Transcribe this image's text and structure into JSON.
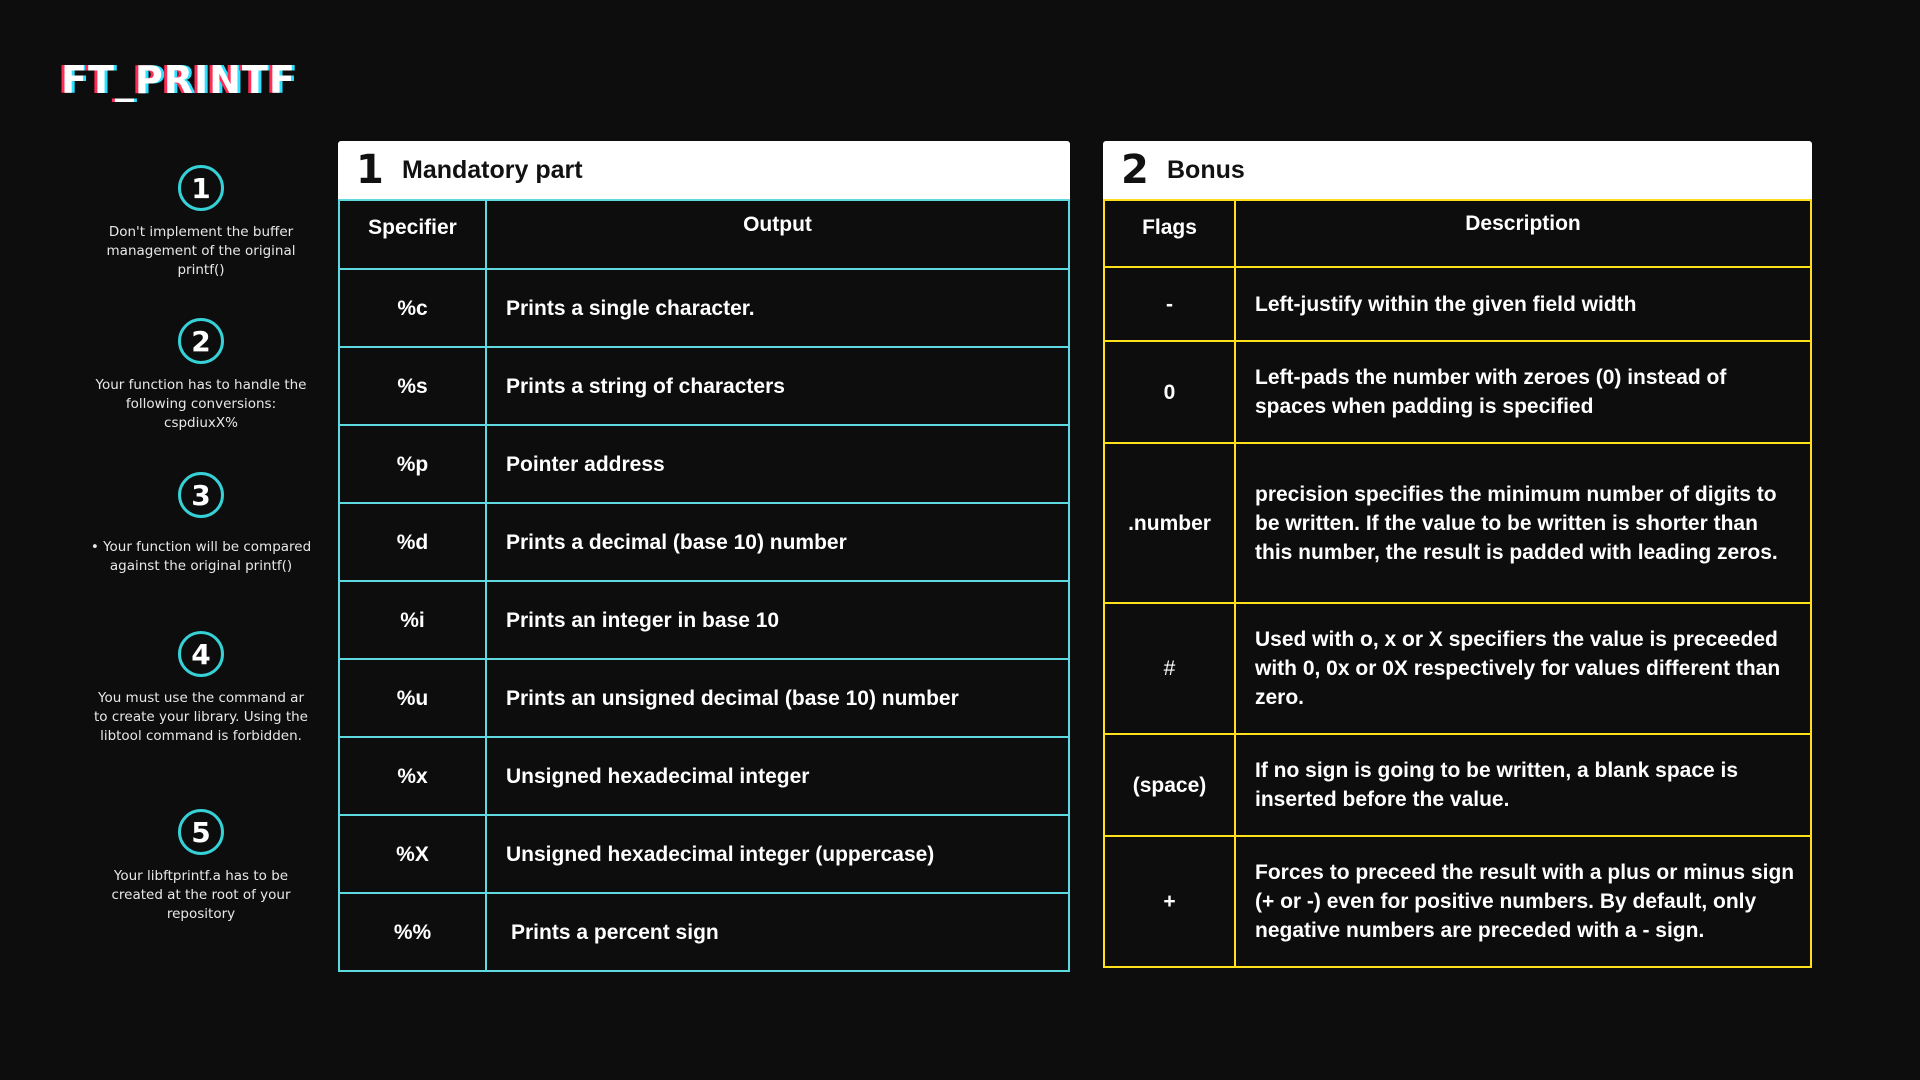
{
  "title": "FT_PRINTF",
  "steps": [
    {
      "num": "1",
      "text": "Don't implement the buffer management of the original printf()"
    },
    {
      "num": "2",
      "text": "Your function has to handle the following conversions: cspdiuxX%"
    },
    {
      "num": "3",
      "text": "• Your function will be compared against the original printf()"
    },
    {
      "num": "4",
      "text": "You must use the command ar to create your library. Using the libtool command is forbidden."
    },
    {
      "num": "5",
      "text": "Your libftprintf.a has to be created at the root of your repository"
    }
  ],
  "mandatory": {
    "number": "1",
    "title": "Mandatory part",
    "col1": "Specifier",
    "col2": "Output",
    "rows": [
      {
        "spec": "%c",
        "out": "Prints a single character."
      },
      {
        "spec": "%s",
        "out": "Prints a string of characters"
      },
      {
        "spec": "%p",
        "out": "Pointer address"
      },
      {
        "spec": "%d",
        "out": "Prints a decimal (base 10) number"
      },
      {
        "spec": "%i",
        "out": "Prints an integer in base 10"
      },
      {
        "spec": "%u",
        "out": "Prints an unsigned decimal (base 10) number"
      },
      {
        "spec": "%x",
        "out": "Unsigned hexadecimal integer"
      },
      {
        "spec": "%X",
        "out": "Unsigned hexadecimal integer (uppercase)"
      },
      {
        "spec": "%%",
        "out": "Prints a percent sign"
      }
    ]
  },
  "bonus": {
    "number": "2",
    "title": "Bonus",
    "col1": "Flags",
    "col2": "Description",
    "rows": [
      {
        "flag": "-",
        "desc": "Left-justify within the given field width"
      },
      {
        "flag": "0",
        "desc": "Left-pads the number with zeroes (0) instead of spaces when padding is specified"
      },
      {
        "flag": ".number",
        "desc": "precision specifies the minimum number of digits to be written. If the value to be written is shorter than this number, the result is padded with leading zeros."
      },
      {
        "flag": "#",
        "desc": "Used with o, x or X specifiers the value is preceeded with 0, 0x or 0X respectively for values different than zero."
      },
      {
        "flag": "(space)",
        "desc": "If no sign is going to be written, a blank space is inserted before the value."
      },
      {
        "flag": "+",
        "desc": "Forces to preceed the result with a plus or minus sign (+ or -) even for positive numbers. By default, only negative numbers are preceded with a - sign."
      }
    ]
  },
  "colors": {
    "background": "#0d0d0d",
    "mandatory_border": "#5fd9e0",
    "bonus_border": "#ffe01a",
    "step_circle": "#36d1d6"
  }
}
